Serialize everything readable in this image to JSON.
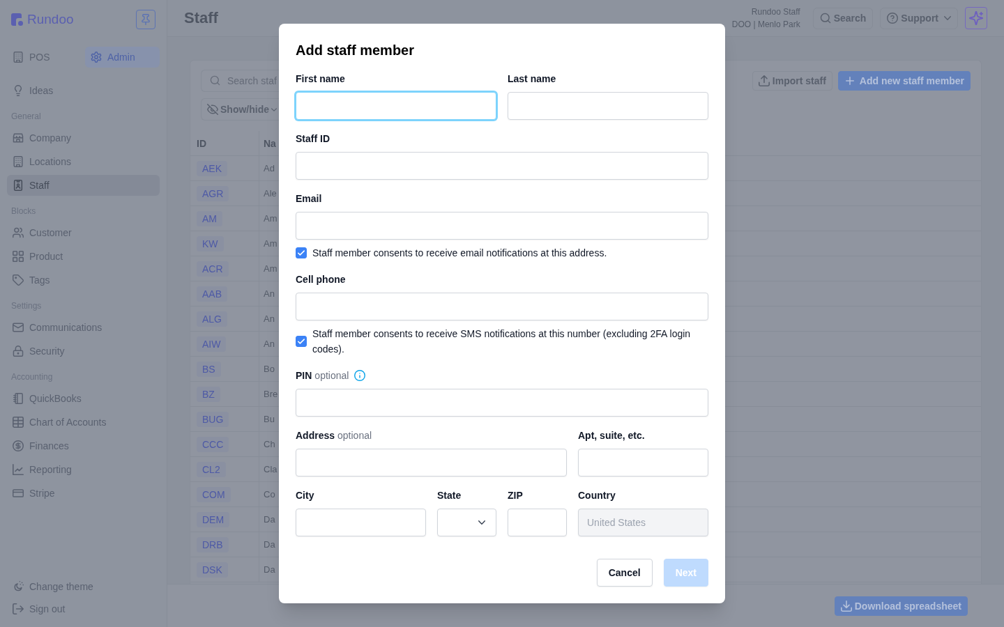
{
  "sidebar": {
    "brand": "Rundoo",
    "modes": [
      {
        "label": "POS",
        "selected": false
      },
      {
        "label": "Admin",
        "selected": true
      }
    ],
    "groups": [
      {
        "items": [
          {
            "label": "Ideas",
            "selected": false
          }
        ]
      },
      {
        "heading": "General",
        "items": [
          {
            "label": "Company",
            "selected": false
          },
          {
            "label": "Locations",
            "selected": false
          },
          {
            "label": "Staff",
            "selected": true
          }
        ]
      },
      {
        "heading": "Blocks",
        "items": [
          {
            "label": "Customer",
            "selected": false
          },
          {
            "label": "Product",
            "selected": false
          },
          {
            "label": "Tags",
            "selected": false
          }
        ]
      },
      {
        "heading": "Settings",
        "items": [
          {
            "label": "Communications",
            "selected": false
          },
          {
            "label": "Security",
            "selected": false
          }
        ]
      },
      {
        "heading": "Accounting",
        "items": [
          {
            "label": "QuickBooks",
            "selected": false
          },
          {
            "label": "Chart of Accounts",
            "selected": false
          },
          {
            "label": "Finances",
            "selected": false
          },
          {
            "label": "Reporting",
            "selected": false
          },
          {
            "label": "Stripe",
            "selected": false
          }
        ]
      }
    ],
    "footer_items": [
      {
        "label": "Change theme"
      },
      {
        "label": "Sign out"
      }
    ]
  },
  "header": {
    "title": "Staff",
    "user_name": "Rundoo Staff",
    "user_location": "DOO | Menlo Park",
    "buttons": [
      {
        "label": "Search",
        "menu": false
      },
      {
        "label": "Support",
        "menu": true
      }
    ]
  },
  "toolbar": {
    "search": {
      "placeholder": "Search staf"
    },
    "show_hide": {
      "label": "Show/hide"
    },
    "actions": [
      {
        "label": "Import staff",
        "kind": "secondary"
      },
      {
        "label": "Add new staff member",
        "kind": "primary"
      }
    ]
  },
  "table": {
    "columns": [
      "ID",
      "Na"
    ],
    "rows": [
      {
        "id": "AEK",
        "name": "Ad"
      },
      {
        "id": "AGR",
        "name": "Ale"
      },
      {
        "id": "AM",
        "name": "Am"
      },
      {
        "id": "KW",
        "name": "Am"
      },
      {
        "id": "ACR",
        "name": "Am"
      },
      {
        "id": "AAB",
        "name": "An"
      },
      {
        "id": "ALG",
        "name": "An"
      },
      {
        "id": "AIW",
        "name": "An"
      },
      {
        "id": "BS",
        "name": "Bo"
      },
      {
        "id": "BZ",
        "name": "Bre"
      },
      {
        "id": "BUG",
        "name": "Bu"
      },
      {
        "id": "CCC",
        "name": "Ch"
      },
      {
        "id": "CL2",
        "name": "Cla"
      },
      {
        "id": "COM",
        "name": "Co"
      },
      {
        "id": "DEM",
        "name": "Da"
      },
      {
        "id": "DRB",
        "name": "Da"
      },
      {
        "id": "DSK",
        "name": "Da"
      }
    ]
  },
  "footer": {
    "download": {
      "label": "Download spreadsheet"
    }
  },
  "dialog": {
    "title": "Add staff member",
    "rows": [
      {
        "kind": "fields",
        "fields": [
          {
            "kind": "text",
            "label": "First name",
            "focused": true,
            "disabled": false
          },
          {
            "kind": "text",
            "label": "Last name",
            "focused": false,
            "disabled": false
          }
        ]
      },
      {
        "kind": "fields",
        "fields": [
          {
            "kind": "text",
            "label": "Staff ID",
            "focused": false,
            "disabled": false
          }
        ]
      },
      {
        "kind": "fields",
        "fields": [
          {
            "kind": "text",
            "label": "Email",
            "focused": false,
            "disabled": false
          }
        ]
      },
      {
        "kind": "consent",
        "label": "Staff member consents to receive email notifications at this address.",
        "checked": true
      },
      {
        "kind": "fields",
        "fields": [
          {
            "kind": "text",
            "label": "Cell phone",
            "focused": false,
            "disabled": false
          }
        ]
      },
      {
        "kind": "consent",
        "label": "Staff member consents to receive SMS notifications at this number (excluding 2FA login codes).",
        "checked": true
      },
      {
        "kind": "fields",
        "fields": [
          {
            "kind": "text",
            "label": "PIN",
            "note": "optional",
            "info": true,
            "focused": false,
            "disabled": false
          }
        ]
      },
      {
        "kind": "fields",
        "fields": [
          {
            "kind": "text",
            "label": "Address",
            "note": "optional",
            "focused": false,
            "disabled": false
          },
          {
            "kind": "text",
            "label": "Apt, suite, etc.",
            "focused": false,
            "disabled": false
          }
        ]
      },
      {
        "kind": "fields",
        "fields": [
          {
            "kind": "text",
            "label": "City",
            "focused": false,
            "disabled": false
          },
          {
            "kind": "select",
            "label": "State",
            "focused": false,
            "disabled": false
          },
          {
            "kind": "text",
            "label": "ZIP",
            "focused": false,
            "disabled": false
          },
          {
            "kind": "text",
            "label": "Country",
            "value": "United States",
            "focused": false,
            "disabled": true
          }
        ]
      }
    ],
    "buttons": [
      {
        "label": "Cancel",
        "kind": "secondary",
        "disabled": false
      },
      {
        "label": "Next",
        "kind": "primary",
        "disabled": true
      }
    ]
  }
}
